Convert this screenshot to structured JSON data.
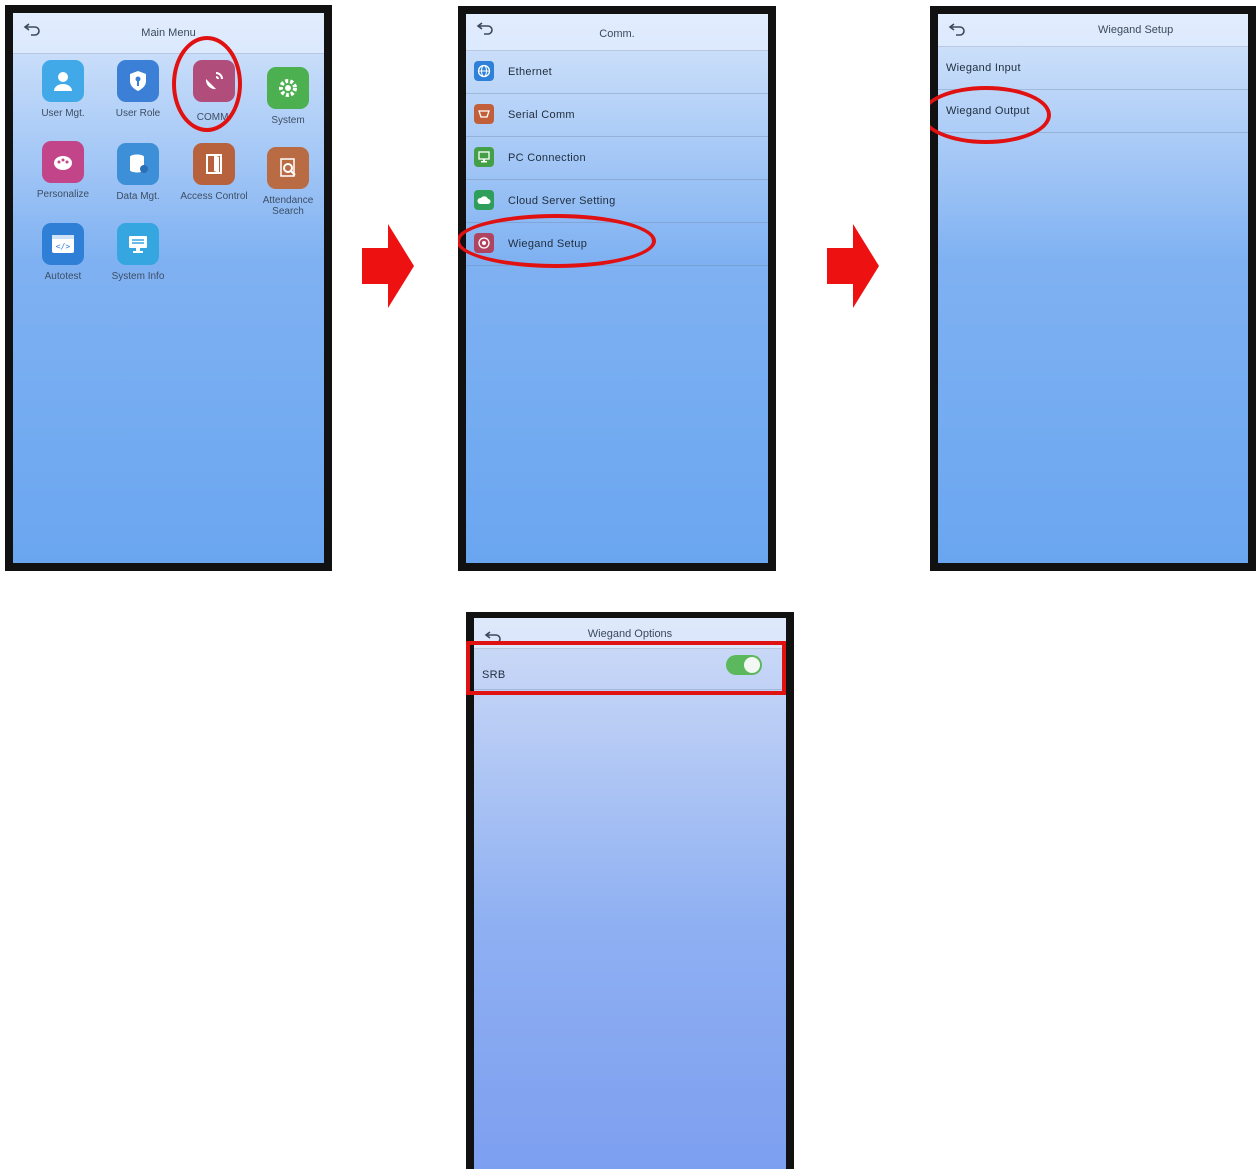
{
  "screens": {
    "main_menu": {
      "title": "Main Menu",
      "apps": [
        {
          "label": "User Mgt.",
          "icon": "user-icon",
          "color": "#41a9e8"
        },
        {
          "label": "User Role",
          "icon": "shield-icon",
          "color": "#3b7fd6"
        },
        {
          "label": "COMM.",
          "icon": "satellite-dish-icon",
          "color": "#b04d7a"
        },
        {
          "label": "System",
          "icon": "gear-icon",
          "color": "#4caf50"
        },
        {
          "label": "Personalize",
          "icon": "palette-icon",
          "color": "#c2458a"
        },
        {
          "label": "Data Mgt.",
          "icon": "database-icon",
          "color": "#3d8fd8"
        },
        {
          "label": "Access Control",
          "icon": "door-icon",
          "color": "#b7623d"
        },
        {
          "label": "Attendance Search",
          "icon": "magnifier-document-icon",
          "color": "#b96b43"
        },
        {
          "label": "Autotest",
          "icon": "code-window-icon",
          "color": "#2f7fd6"
        },
        {
          "label": "System Info",
          "icon": "monitor-icon",
          "color": "#35a6e0"
        }
      ]
    },
    "comm": {
      "title": "Comm.",
      "items": [
        {
          "label": "Ethernet",
          "icon": "globe-icon",
          "color": "#2f80d8"
        },
        {
          "label": "Serial Comm",
          "icon": "serial-port-icon",
          "color": "#c25f3b"
        },
        {
          "label": "PC Connection",
          "icon": "pc-icon",
          "color": "#43a047"
        },
        {
          "label": "Cloud Server Setting",
          "icon": "cloud-icon",
          "color": "#2e9e5b"
        },
        {
          "label": "Wiegand Setup",
          "icon": "wiegand-icon",
          "color": "#b0435f"
        }
      ]
    },
    "wiegand_setup": {
      "title": "Wiegand Setup",
      "items": [
        {
          "label": "Wiegand Input"
        },
        {
          "label": "Wiegand Output"
        }
      ]
    },
    "wiegand_options": {
      "title": "Wiegand Options",
      "items": [
        {
          "label": "SRB",
          "toggle_on": true
        }
      ]
    }
  },
  "highlight_color": "#e01111",
  "toggle_color": "#5cb85c"
}
